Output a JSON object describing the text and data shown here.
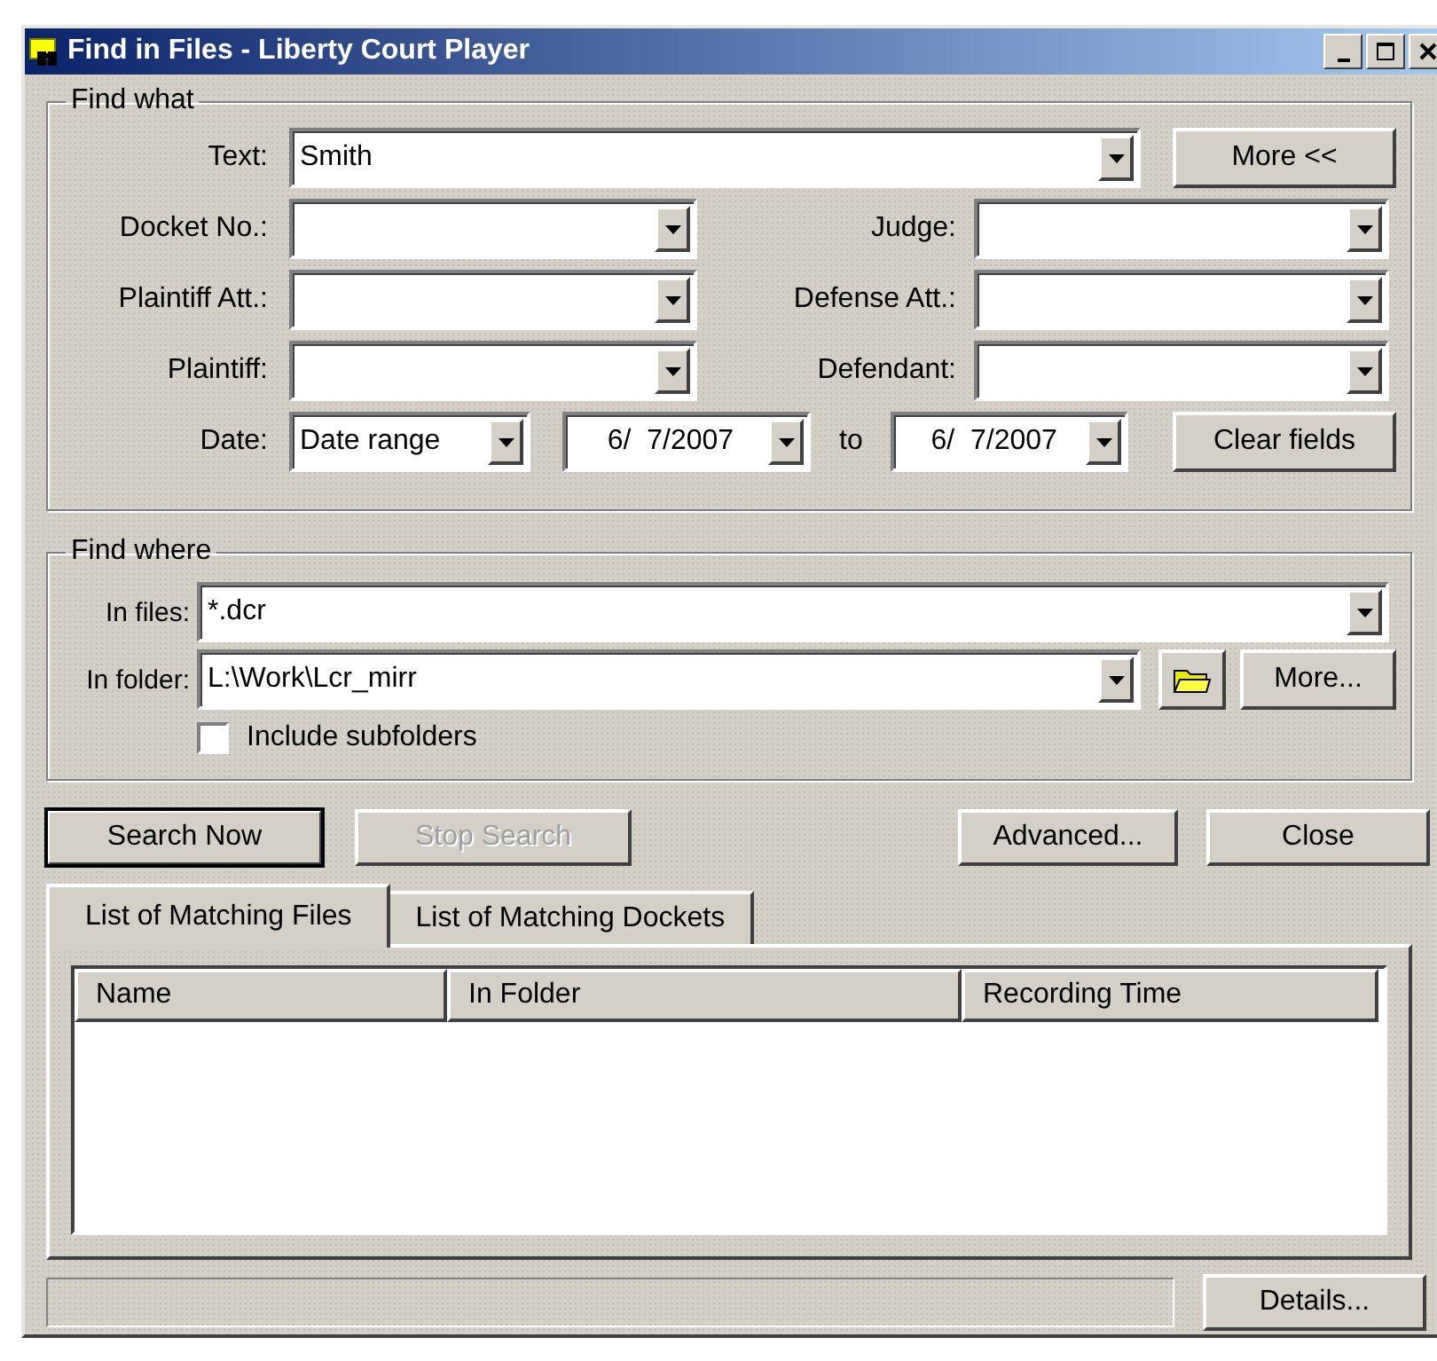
{
  "window": {
    "title": "Find in Files - Liberty Court Player"
  },
  "find_what": {
    "title": "Find what",
    "text": {
      "label": "Text:",
      "value": "Smith"
    },
    "more_button": "More <<",
    "fields": [
      {
        "label": "Docket No.:"
      },
      {
        "label": "Judge:"
      },
      {
        "label": "Plaintiff Att.:"
      },
      {
        "label": "Defense Att.:"
      },
      {
        "label": "Plaintiff:"
      },
      {
        "label": "Defendant:"
      }
    ],
    "date": {
      "label": "Date:",
      "mode": "Date range",
      "from": "6/  7/2007",
      "to_label": "to",
      "to": "6/  7/2007"
    },
    "clear_button": "Clear fields"
  },
  "find_where": {
    "title": "Find where",
    "in_files": {
      "label": "In files:",
      "value": "*.dcr"
    },
    "in_folder": {
      "label": "In folder:",
      "value": "L:\\Work\\Lcr_mirr"
    },
    "more_button": "More...",
    "include_subfolders": {
      "label": "Include subfolders",
      "checked": false
    }
  },
  "buttons": [
    {
      "label": "Search Now",
      "disabled": false,
      "default": true
    },
    {
      "label": "Stop Search",
      "disabled": true,
      "default": false
    },
    {
      "label": "Advanced...",
      "disabled": false,
      "default": false
    },
    {
      "label": "Close",
      "disabled": false,
      "default": false
    }
  ],
  "tabs": [
    {
      "label": "List of Matching Files",
      "selected": true
    },
    {
      "label": "List of Matching Dockets",
      "selected": false
    }
  ],
  "table": {
    "columns": [
      "Name",
      "In Folder",
      "Recording Time"
    ]
  },
  "status_bar": {
    "details_button": "Details..."
  }
}
